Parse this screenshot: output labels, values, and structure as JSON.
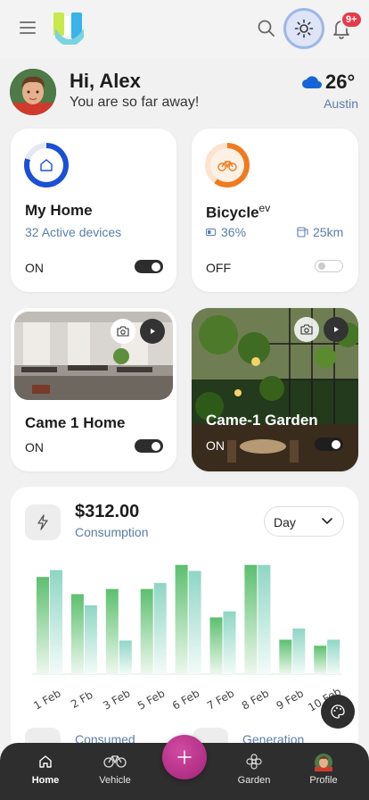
{
  "header": {
    "menu_icon": "hamburger-icon",
    "search_icon": "search-icon",
    "theme_icon": "sun-icon",
    "notifications_icon": "bell-icon",
    "notification_count": "9+"
  },
  "greeting": {
    "title": "Hi, Alex",
    "subtitle": "You are so far away!"
  },
  "weather": {
    "icon": "cloud-icon",
    "temperature": "26°",
    "city": "Austin"
  },
  "devices": {
    "home": {
      "title": "My Home",
      "subtitle": "32 Active devices",
      "state": "ON",
      "enabled": true,
      "ring_color": "#1a4fd6",
      "ring_progress": 0.8
    },
    "bicycle": {
      "title": "Bicycle",
      "title_sup": "ev",
      "battery": "36%",
      "range": "25km",
      "state": "OFF",
      "enabled": false,
      "ring_color": "#f07b1f",
      "ring_progress": 0.6
    }
  },
  "cameras": {
    "home": {
      "title": "Came 1 Home",
      "state": "ON",
      "enabled": true
    },
    "garden": {
      "title": "Came-1 Garden",
      "state": "ON",
      "enabled": true
    }
  },
  "consumption": {
    "amount": "$312.00",
    "label": "Consumption",
    "period": "Day",
    "consumed_label": "Consumed",
    "generation_label": "Generation"
  },
  "chart_data": {
    "type": "bar",
    "categories": [
      "1 Feb",
      "2 Fb",
      "3 Feb",
      "5 Feb",
      "6 Feb",
      "7 Feb",
      "8 Feb",
      "9 Feb",
      "10 Feb"
    ],
    "series": [
      {
        "values": [
          113,
          93,
          99,
          99,
          127,
          66,
          127,
          40,
          33
        ]
      },
      {
        "values": [
          121,
          80,
          39,
          106,
          120,
          73,
          127,
          53,
          40
        ]
      }
    ],
    "ylim": [
      0,
      135
    ],
    "grid": false
  },
  "nav": {
    "items": [
      {
        "label": "Home",
        "icon": "home-icon"
      },
      {
        "label": "Vehicle",
        "icon": "bicycle-icon"
      },
      {
        "label": "Garden",
        "icon": "flower-icon"
      },
      {
        "label": "Profile",
        "icon": "avatar"
      }
    ],
    "fab_icon": "plus-icon"
  }
}
